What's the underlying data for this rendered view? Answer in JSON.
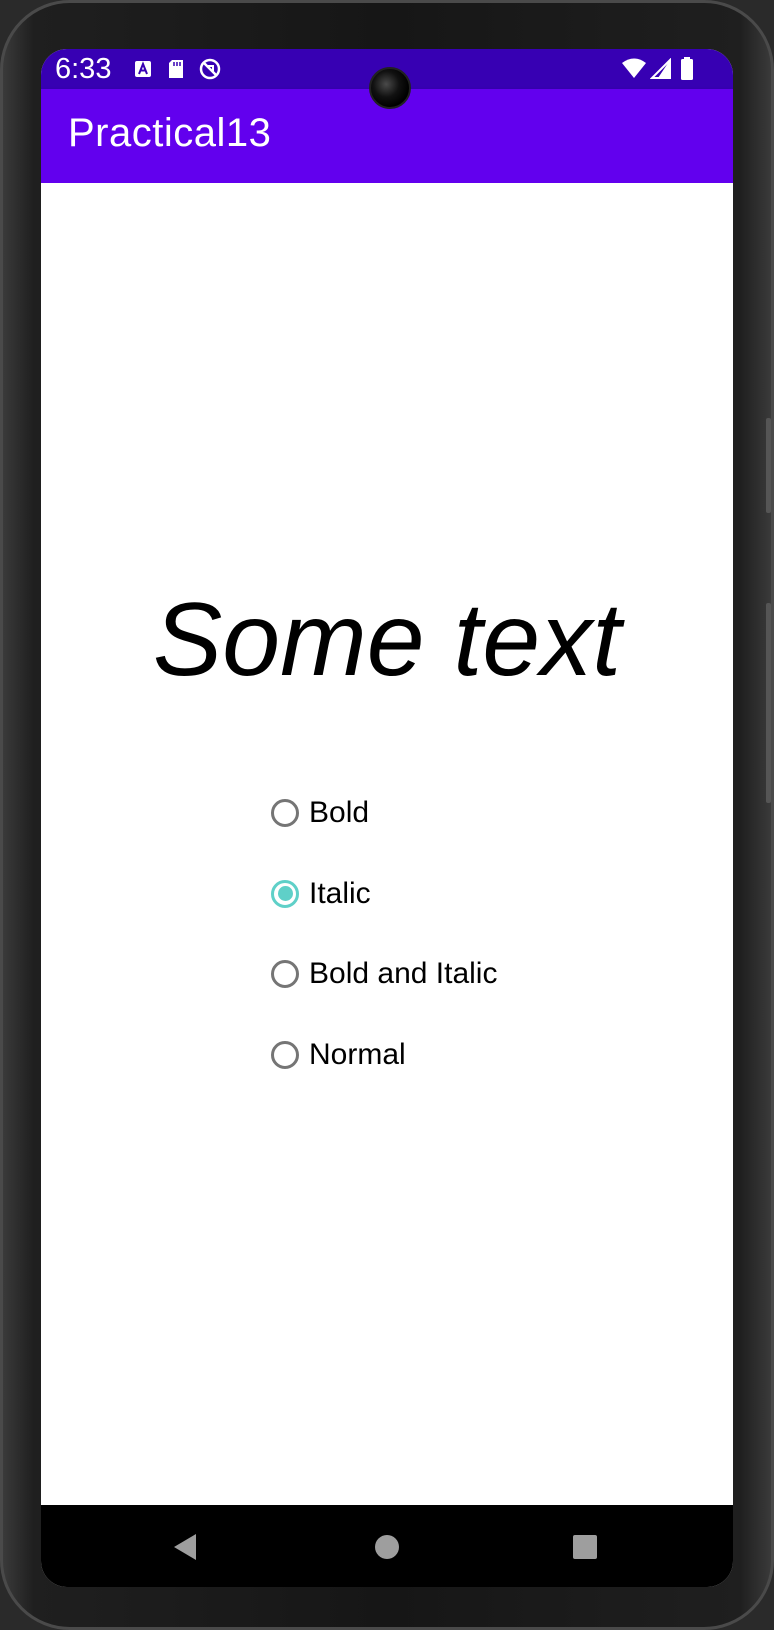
{
  "status_bar": {
    "time": "6:33",
    "background": "#3700b3",
    "left_icons": [
      "a-icon",
      "sd-card-icon",
      "no-disturb-icon"
    ],
    "right_icons": [
      "wifi-icon",
      "signal-icon",
      "battery-icon"
    ]
  },
  "app_bar": {
    "title": "Practical13",
    "background": "#6200ee"
  },
  "main": {
    "sample_text": "Some text",
    "sample_style": "italic",
    "accent_color": "#5fd0c8",
    "radio_options": [
      {
        "label": "Bold",
        "checked": false
      },
      {
        "label": "Italic",
        "checked": true
      },
      {
        "label": "Bold and Italic",
        "checked": false
      },
      {
        "label": "Normal",
        "checked": false
      }
    ]
  },
  "nav_bar": {
    "buttons": [
      "back-icon",
      "home-icon",
      "recents-icon"
    ]
  }
}
